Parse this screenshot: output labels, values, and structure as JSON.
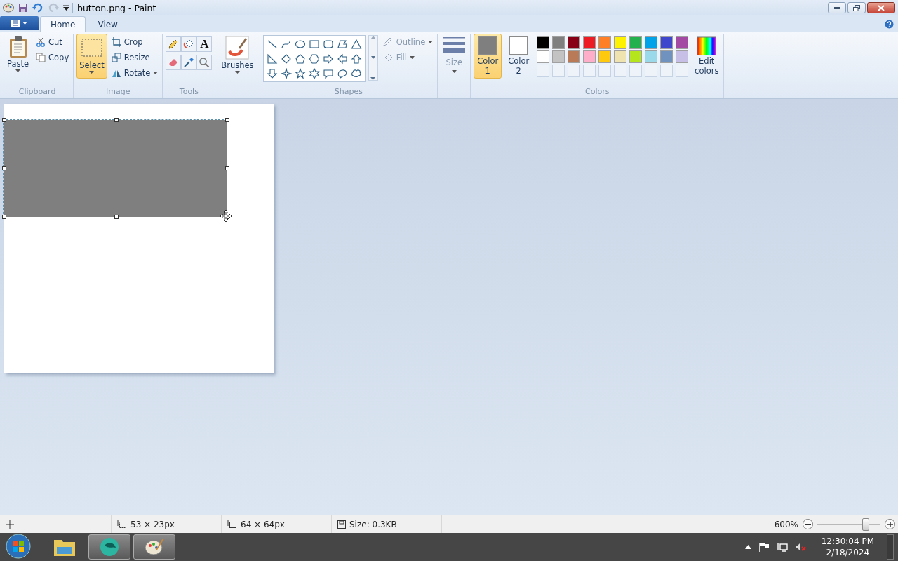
{
  "window": {
    "title": "button.png - Paint"
  },
  "tabs": [
    {
      "label": "Home",
      "selected": true
    },
    {
      "label": "View",
      "selected": false
    }
  ],
  "clipboard": {
    "label": "Clipboard",
    "paste": "Paste",
    "cut": "Cut",
    "copy": "Copy"
  },
  "image": {
    "label": "Image",
    "select": {
      "label": "Select",
      "selected": true
    },
    "crop": "Crop",
    "resize": "Resize",
    "rotate": "Rotate"
  },
  "tools": {
    "label": "Tools",
    "text_glyph": "A"
  },
  "brushes": {
    "label": "Brushes"
  },
  "shapes": {
    "label": "Shapes",
    "outline": {
      "label": "Outline",
      "disabled": true
    },
    "fill": {
      "label": "Fill",
      "disabled": true
    }
  },
  "size": {
    "label": "Size",
    "disabled": true
  },
  "colors": {
    "label": "Colors",
    "color1": {
      "label": "Color 1",
      "color": "#7f7f7f",
      "selected": true
    },
    "color2": {
      "label": "Color 2",
      "color": "#ffffff",
      "selected": false
    },
    "palette": [
      {
        "color": "#000000"
      },
      {
        "color": "#7f7f7f"
      },
      {
        "color": "#880015"
      },
      {
        "color": "#ed1c24"
      },
      {
        "color": "#ff7f27"
      },
      {
        "color": "#fff200"
      },
      {
        "color": "#22b14c"
      },
      {
        "color": "#00a2e8"
      },
      {
        "color": "#3f48cc"
      },
      {
        "color": "#a349a4"
      },
      {
        "color": "#ffffff"
      },
      {
        "color": "#c3c3c3"
      },
      {
        "color": "#b97a57"
      },
      {
        "color": "#ffaec9"
      },
      {
        "color": "#ffc90e"
      },
      {
        "color": "#efe4b0"
      },
      {
        "color": "#b5e61d"
      },
      {
        "color": "#99d9ea"
      },
      {
        "color": "#7092be"
      },
      {
        "color": "#c8bfe7"
      }
    ],
    "edit": "Edit colors"
  },
  "status_bar": {
    "selection_size": "53 × 23px",
    "image_size": "64 × 64px",
    "file_size": "Size: 0.3KB",
    "zoom": "600%",
    "zoom_level": {
      "level": 0.8
    }
  },
  "taskbar": {
    "time": "12:30:04 PM",
    "date": "2/18/2024"
  }
}
